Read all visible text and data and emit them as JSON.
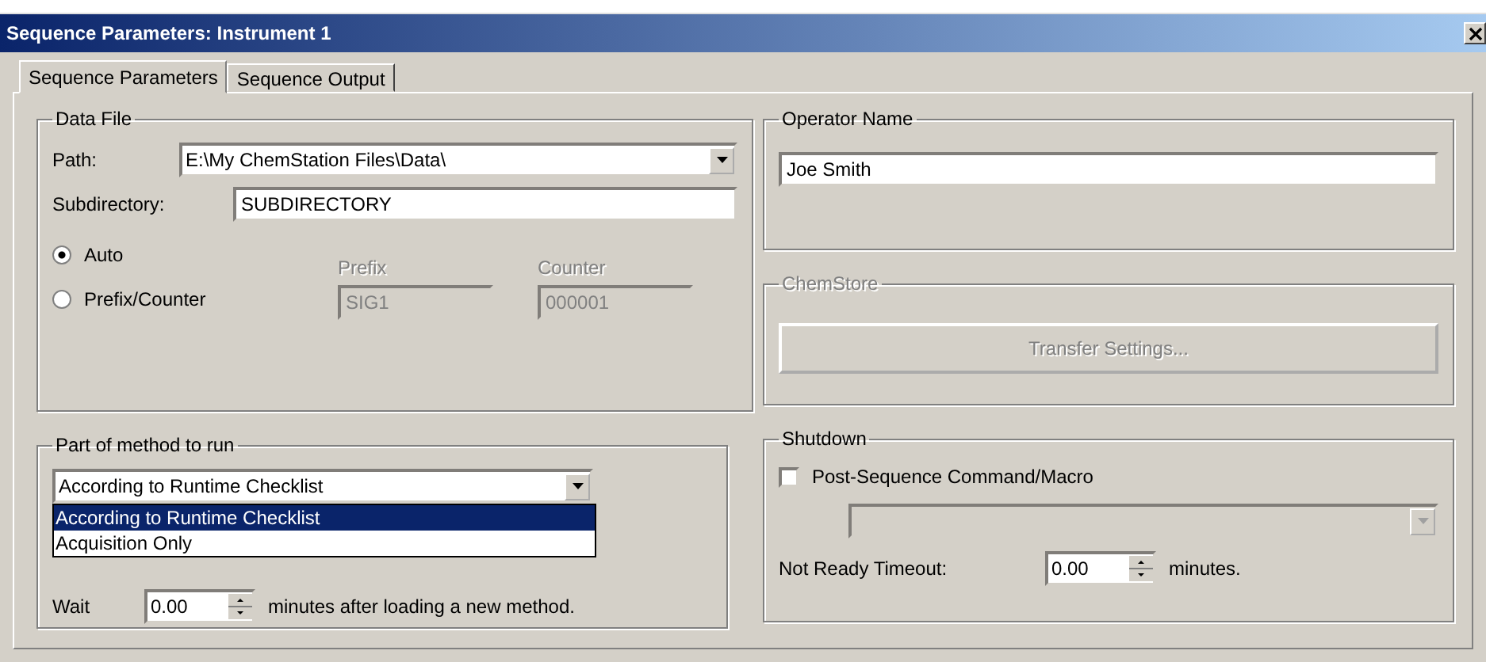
{
  "window": {
    "title": "Sequence Parameters: Instrument 1"
  },
  "tabs": [
    {
      "label": "Sequence Parameters",
      "selected": true
    },
    {
      "label": "Sequence Output",
      "selected": false
    }
  ],
  "data_file": {
    "title": "Data File",
    "path_label": "Path:",
    "path": "E:\\My ChemStation Files\\Data\\",
    "subdir_label": "Subdirectory:",
    "subdir": "SUBDIRECTORY",
    "radios": [
      {
        "label": "Auto",
        "selected": true
      },
      {
        "label": "Prefix/Counter",
        "selected": false
      }
    ],
    "prefix": {
      "label": "Prefix",
      "value": "SIG1",
      "disabled": true
    },
    "counter": {
      "label": "Counter",
      "value": "000001",
      "disabled": true
    }
  },
  "operator": {
    "title": "Operator Name",
    "value": "Joe Smith"
  },
  "chemstore": {
    "title": "ChemStore",
    "button": "Transfer Settings...",
    "disabled": true
  },
  "method": {
    "title": "Part of method to run",
    "value": "According to Runtime Checklist",
    "expanded": true,
    "options": [
      {
        "label": "According to Runtime Checklist",
        "selected": true
      },
      {
        "label": "Acquisition Only",
        "selected": false
      }
    ],
    "wait_label": "Wait",
    "wait_value": "0.00",
    "wait_suffix": "minutes after loading a new method."
  },
  "shutdown": {
    "title": "Shutdown",
    "checkbox": {
      "label": "Post-Sequence Command/Macro",
      "checked": false
    },
    "command_disabled": true,
    "timeout_label": "Not Ready Timeout:",
    "timeout_value": "0.00",
    "timeout_suffix": "minutes."
  }
}
